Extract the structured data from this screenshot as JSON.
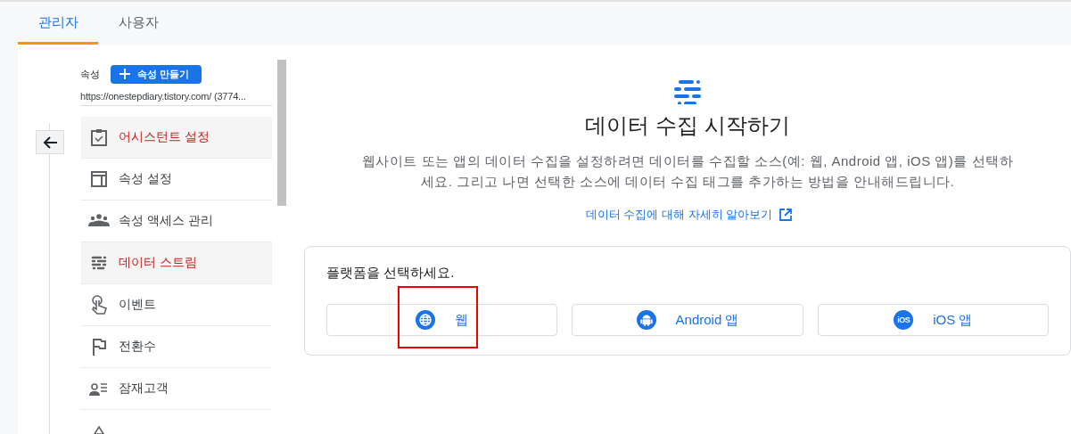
{
  "tabs": [
    {
      "label": "관리자",
      "selected": true
    },
    {
      "label": "사용자",
      "selected": false
    }
  ],
  "sidebar": {
    "property_label": "속성",
    "create_button": "속성 만들기",
    "property_url": "https://onestepdiary.tistory.com/ (3774...",
    "items": [
      {
        "kind": "checklist",
        "label": "어시스턴트 설정",
        "selected": true
      },
      {
        "kind": "layout",
        "label": "속성 설정",
        "selected": false
      },
      {
        "kind": "people",
        "label": "속성 액세스 관리",
        "selected": false
      },
      {
        "kind": "streams",
        "label": "데이터 스트림",
        "selected": true
      },
      {
        "kind": "touch",
        "label": "이벤트",
        "selected": false
      },
      {
        "kind": "flag",
        "label": "전환수",
        "selected": false
      },
      {
        "kind": "audience",
        "label": "잠재고객",
        "selected": false
      },
      {
        "kind": "custom"
      }
    ]
  },
  "main": {
    "title": "데이터 수집 시작하기",
    "description": "웹사이트 또는 앱의 데이터 수집을 설정하려면 데이터를 수집할 소스(예: 웹, Android 앱, iOS 앱)를 선택하세요. 그리고 나면 선택한 소스에 데이터 수집 태그를 추가하는 방법을 안내해드립니다.",
    "link": "데이터 수집에 대해 자세히 알아보기",
    "platform_card": {
      "heading": "플랫폼을 선택하세요.",
      "platforms": [
        {
          "kind": "web",
          "label": "웹"
        },
        {
          "kind": "android",
          "label": "Android 앱"
        },
        {
          "kind": "ios",
          "label": "iOS 앱",
          "icon_text": "iOS"
        }
      ]
    }
  }
}
